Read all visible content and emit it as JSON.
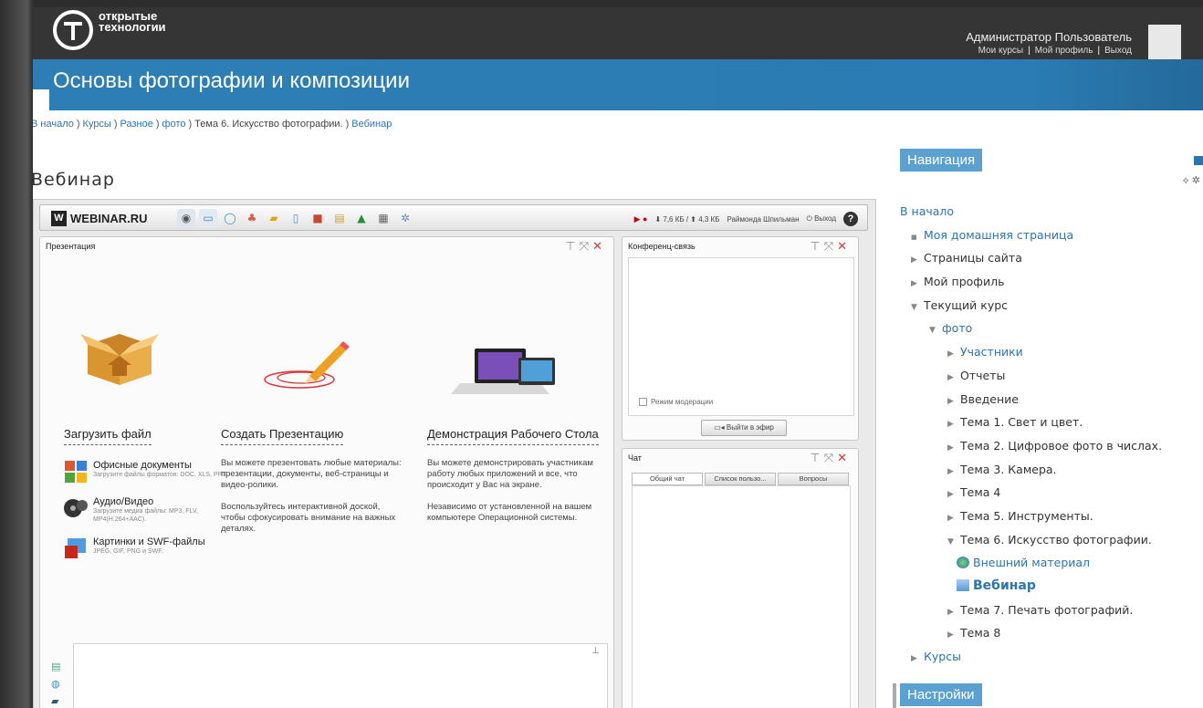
{
  "site": {
    "logo_line1": "открытые",
    "logo_line2": "технологии",
    "user_name": "Администратор Пользователь",
    "links": [
      "Мои курсы",
      "Мой профиль",
      "Выход"
    ],
    "course_title": "Основы фотографии и композиции"
  },
  "breadcrumb": [
    {
      "label": "В начало",
      "link": true
    },
    {
      "label": "Курсы",
      "link": true
    },
    {
      "label": "Разное",
      "link": true
    },
    {
      "label": "фото",
      "link": true
    },
    {
      "label": "Тема 6. Искусство фотографии.",
      "link": false
    },
    {
      "label": "Вебинар",
      "link": true
    }
  ],
  "page_heading": "Вебинар",
  "webinar": {
    "brand": "WEBINAR.RU",
    "brand_letter": "W",
    "traffic": "⬇ 7,6 КБ / ⬆ 4,3 КБ",
    "user": "Раймонда Шпильман",
    "logout": "Выход",
    "help": "?",
    "presentation_title": "Презентация",
    "features": [
      {
        "title": "Загрузить файл",
        "items": [
          {
            "name": "Офисные документы",
            "sub": "Загрузите файлы форматов: DOC, XLS, PPT."
          },
          {
            "name": "Аудио/Видео",
            "sub": "Загрузите медиа файлы: MP3, FLV, MP4(H.264+AAC)."
          },
          {
            "name": "Картинки и SWF-файлы",
            "sub": "JPEG, GIF, PNG и SWF."
          }
        ]
      },
      {
        "title": "Создать Презентацию",
        "paragraphs": [
          "Вы можете презентовать любые материалы: презентации, документы, веб-страницы и видео-ролики.",
          "Воспользуйтесь интерактивной доской, чтобы сфокусировать внимание на важных деталях."
        ]
      },
      {
        "title": "Демонстрация Рабочего Стола",
        "paragraphs": [
          "Вы можете демонстрировать участникам работу любых приложений и все, что происходит у Вас на экране.",
          "Независимо от установленной на вашем компьютере Операционной системы."
        ]
      }
    ],
    "conference_title": "Конференц-связь",
    "moderation_label": "Режим модерации",
    "go_live_label": "Выйти в эфир",
    "chat_title": "Чат",
    "chat_tabs": [
      "Общий чат",
      "Список пользо...",
      "Вопросы"
    ]
  },
  "navigation": {
    "title": "Навигация",
    "items": [
      {
        "label": "В начало",
        "link": true,
        "indent": 0,
        "marker": "none"
      },
      {
        "label": "Моя домашняя страница",
        "link": true,
        "indent": 1,
        "marker": "square"
      },
      {
        "label": "Страницы сайта",
        "link": false,
        "indent": 1,
        "marker": "right"
      },
      {
        "label": "Мой профиль",
        "link": false,
        "indent": 1,
        "marker": "right"
      },
      {
        "label": "Текущий курс",
        "link": false,
        "indent": 1,
        "marker": "down"
      },
      {
        "label": "фото",
        "link": true,
        "indent": 2,
        "marker": "down"
      },
      {
        "label": "Участники",
        "link": true,
        "indent": 3,
        "marker": "right"
      },
      {
        "label": "Отчеты",
        "link": false,
        "indent": 3,
        "marker": "right"
      },
      {
        "label": "Введение",
        "link": false,
        "indent": 3,
        "marker": "right"
      },
      {
        "label": "Тема 1. Свет и цвет.",
        "link": false,
        "indent": 3,
        "marker": "right"
      },
      {
        "label": "Тема 2. Цифровое фото в числах.",
        "link": false,
        "indent": 3,
        "marker": "right"
      },
      {
        "label": "Тема 3. Камера.",
        "link": false,
        "indent": 3,
        "marker": "right"
      },
      {
        "label": "Тема 4",
        "link": false,
        "indent": 3,
        "marker": "right"
      },
      {
        "label": "Тема 5. Инструменты.",
        "link": false,
        "indent": 3,
        "marker": "right"
      },
      {
        "label": "Тема 6. Искусство фотографии.",
        "link": false,
        "indent": 3,
        "marker": "down"
      },
      {
        "label": "Внешний материал",
        "link": true,
        "indent": 4,
        "marker": "globe"
      },
      {
        "label": "Вебинар",
        "link": true,
        "indent": 4,
        "marker": "page",
        "bold": true
      },
      {
        "label": "Тема 7. Печать фотографий.",
        "link": false,
        "indent": 3,
        "marker": "right"
      },
      {
        "label": "Тема 8",
        "link": false,
        "indent": 3,
        "marker": "right"
      },
      {
        "label": "Курсы",
        "link": true,
        "indent": 1,
        "marker": "right"
      }
    ]
  },
  "settings": {
    "title": "Настройки"
  },
  "colors": {
    "header": "#353535",
    "title_bar": "#2d7eb4",
    "link": "#2a75b0",
    "block_header": "#5aa0d0"
  }
}
